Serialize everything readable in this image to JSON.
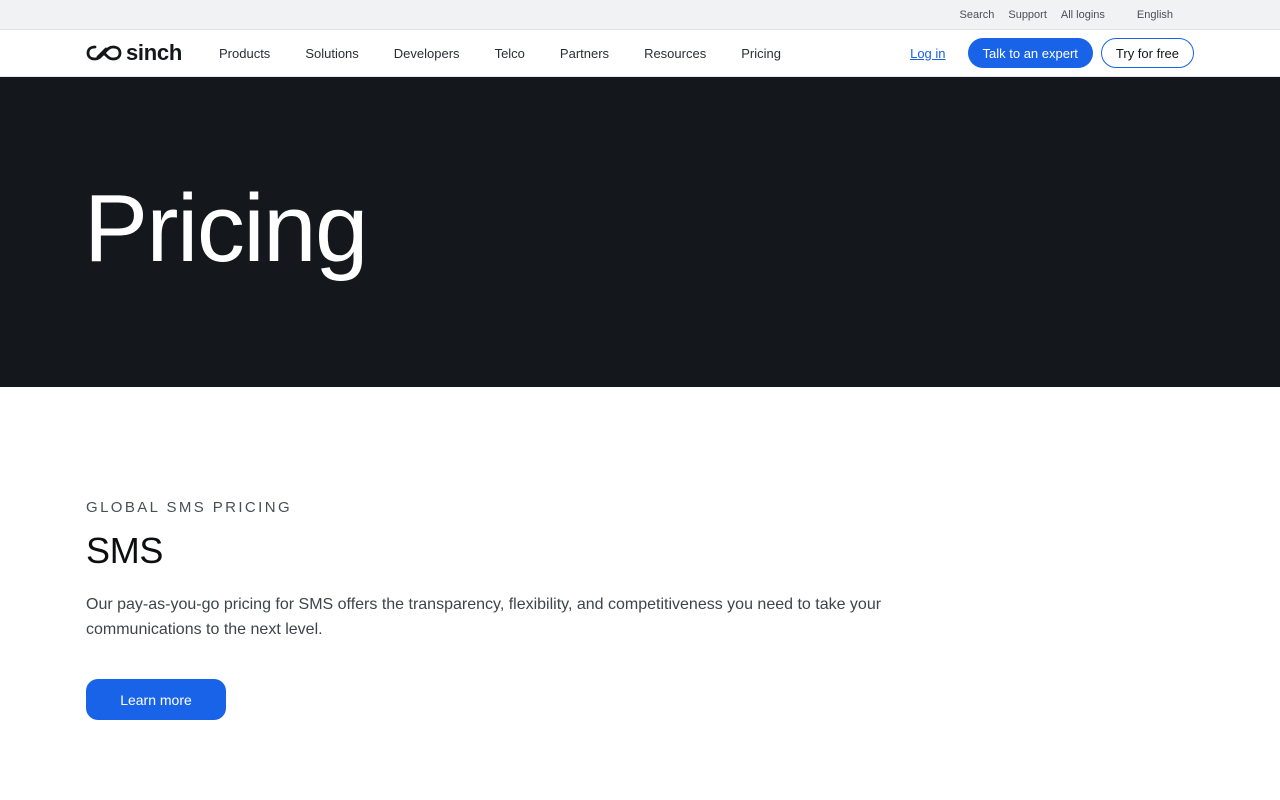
{
  "topbar": {
    "search": "Search",
    "support": "Support",
    "all_logins": "All logins",
    "language": "English"
  },
  "nav": {
    "logo_text": "sinch",
    "items": [
      {
        "label": "Products"
      },
      {
        "label": "Solutions"
      },
      {
        "label": "Developers"
      },
      {
        "label": "Telco"
      },
      {
        "label": "Partners"
      },
      {
        "label": "Resources"
      },
      {
        "label": "Pricing"
      }
    ],
    "login": "Log in",
    "talk_expert": "Talk to an expert",
    "try_free": "Try for free"
  },
  "hero": {
    "title": "Pricing"
  },
  "sms_section": {
    "eyebrow": "GLOBAL SMS PRICING",
    "heading": "SMS",
    "description": "Our pay-as-you-go pricing for SMS offers the transparency, flexibility, and competitiveness you need to take your communications to the next level.",
    "button": "Learn more"
  },
  "colors": {
    "accent": "#1963e8",
    "hero_bg": "#14181c",
    "topbar_bg": "#f1f2f4"
  }
}
